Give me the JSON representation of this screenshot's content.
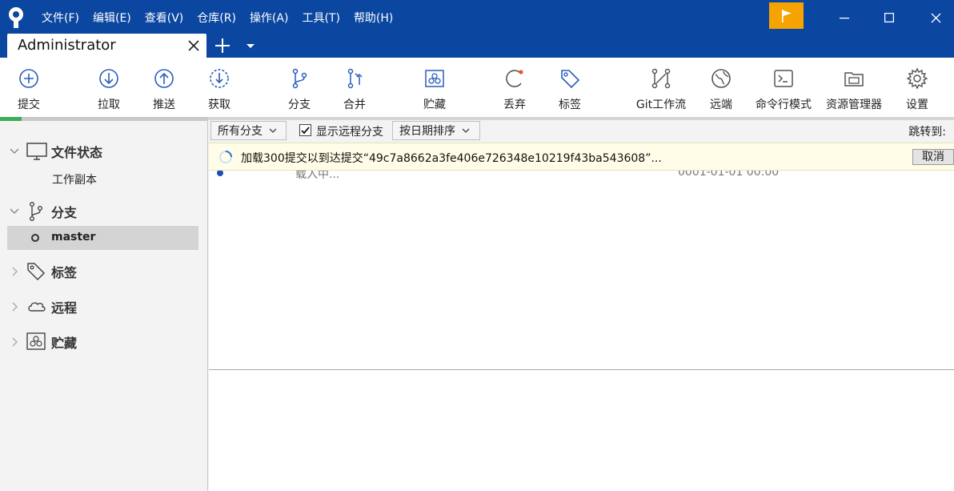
{
  "menu": [
    "文件(F)",
    "编辑(E)",
    "查看(V)",
    "仓库(R)",
    "操作(A)",
    "工具(T)",
    "帮助(H)"
  ],
  "tab": {
    "title": "Administrator"
  },
  "toolbar": {
    "commit": "提交",
    "pull": "拉取",
    "push": "推送",
    "fetch": "获取",
    "branch": "分支",
    "merge": "合并",
    "stash": "贮藏",
    "discard": "丢弃",
    "tag": "标签",
    "gitflow": "Git工作流",
    "remote": "远端",
    "terminal": "命令行模式",
    "explorer": "资源管理器",
    "settings": "设置"
  },
  "sidebar": {
    "file_status": "文件状态",
    "working_copy": "工作副本",
    "branches": "分支",
    "current_branch": "master",
    "tags": "标签",
    "remotes": "远程",
    "stashes": "贮藏"
  },
  "filter": {
    "branches": "所有分支",
    "show_remote": "显示远程分支",
    "sort": "按日期排序",
    "jump_to": "跳转到:"
  },
  "loading": {
    "message": "加载300提交以到达提交“49c7a8662a3fe406e726348e10219f43ba543608”...",
    "cancel": "取消"
  },
  "commit_row": {
    "message": "载入中...",
    "date": "0001-01-01 00:00"
  },
  "colors": {
    "titlebar": "#0b47a1",
    "flag": "#f5a300",
    "accent": "#1f4fb5",
    "progress": "#3dab58"
  }
}
